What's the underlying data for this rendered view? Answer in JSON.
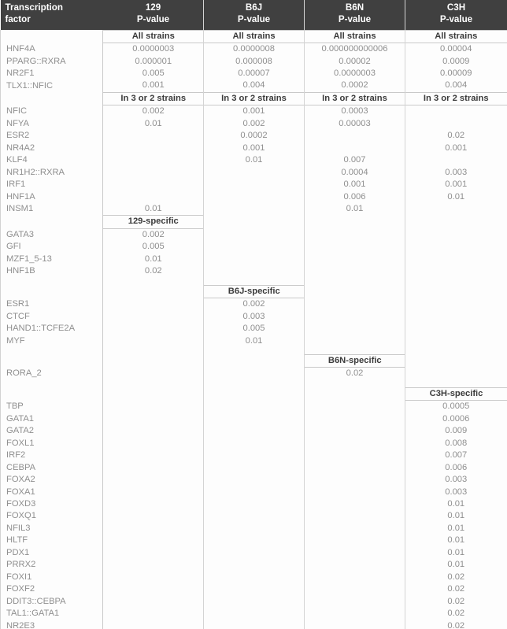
{
  "header": {
    "tf_label_line1": "Transcription",
    "tf_label_line2": "factor",
    "columns": [
      {
        "name": "129",
        "sub": "P-value"
      },
      {
        "name": "B6J",
        "sub": "P-value"
      },
      {
        "name": "B6N",
        "sub": "P-value"
      },
      {
        "name": "C3H",
        "sub": "P-value"
      }
    ]
  },
  "section_labels": {
    "all_strains": "All strains",
    "in_3_or_2": "In 3 or 2 strains",
    "s129_specific": "129-specific",
    "b6j_specific": "B6J-specific",
    "b6n_specific": "B6N-specific",
    "c3h_specific": "C3H-specific"
  },
  "colors": {
    "header_bg": "#404040",
    "header_text": "#ffffff",
    "body_text": "#8f8f8f",
    "section_text": "#3b3b3b",
    "rule": "#c9c9c9"
  },
  "rows": [
    {
      "type": "section",
      "cells": [
        "All strains",
        "All strains",
        "All strains",
        "All strains"
      ]
    },
    {
      "type": "data",
      "tf": "HNF4A",
      "cells": [
        "0.0000003",
        "0.0000008",
        "0.000000000006",
        "0.00004"
      ]
    },
    {
      "type": "data",
      "tf": "PPARG::RXRA",
      "cells": [
        "0.000001",
        "0.000008",
        "0.00002",
        "0.0009"
      ]
    },
    {
      "type": "data",
      "tf": "NR2F1",
      "cells": [
        "0.005",
        "0.00007",
        "0.0000003",
        "0.00009"
      ]
    },
    {
      "type": "data",
      "tf": "TLX1::NFIC",
      "cells": [
        "0.001",
        "0.004",
        "0.0002",
        "0.004"
      ]
    },
    {
      "type": "section",
      "cells": [
        "In 3 or 2 strains",
        "In 3 or 2 strains",
        "In 3 or 2 strains",
        "In 3 or 2 strains"
      ]
    },
    {
      "type": "data",
      "tf": "NFIC",
      "cells": [
        "0.002",
        "0.001",
        "0.0003",
        ""
      ]
    },
    {
      "type": "data",
      "tf": "NFYA",
      "cells": [
        "0.01",
        "0.002",
        "0.00003",
        ""
      ]
    },
    {
      "type": "data",
      "tf": "ESR2",
      "cells": [
        "",
        "0.0002",
        "",
        "0.02"
      ]
    },
    {
      "type": "data",
      "tf": "NR4A2",
      "cells": [
        "",
        "0.001",
        "",
        "0.001"
      ]
    },
    {
      "type": "data",
      "tf": "KLF4",
      "cells": [
        "",
        "0.01",
        "0.007",
        ""
      ]
    },
    {
      "type": "data",
      "tf": "NR1H2::RXRA",
      "cells": [
        "",
        "",
        "0.0004",
        "0.003"
      ]
    },
    {
      "type": "data",
      "tf": "IRF1",
      "cells": [
        "",
        "",
        "0.001",
        "0.001"
      ]
    },
    {
      "type": "data",
      "tf": "HNF1A",
      "cells": [
        "",
        "",
        "0.006",
        "0.01"
      ]
    },
    {
      "type": "data",
      "tf": "INSM1",
      "cells": [
        "0.01",
        "",
        "0.01",
        ""
      ]
    },
    {
      "type": "section_partial",
      "col": 0,
      "label": "129-specific"
    },
    {
      "type": "data",
      "tf": "GATA3",
      "cells": [
        "0.002",
        "",
        "",
        ""
      ]
    },
    {
      "type": "data",
      "tf": "GFI",
      "cells": [
        "0.005",
        "",
        "",
        ""
      ]
    },
    {
      "type": "data",
      "tf": "MZF1_5-13",
      "cells": [
        "0.01",
        "",
        "",
        ""
      ]
    },
    {
      "type": "data",
      "tf": "HNF1B",
      "cells": [
        "0.02",
        "",
        "",
        ""
      ]
    },
    {
      "type": "gap"
    },
    {
      "type": "section_partial",
      "col": 1,
      "label": "B6J-specific"
    },
    {
      "type": "data",
      "tf": "ESR1",
      "cells": [
        "",
        "0.002",
        "",
        ""
      ]
    },
    {
      "type": "data",
      "tf": "CTCF",
      "cells": [
        "",
        "0.003",
        "",
        ""
      ]
    },
    {
      "type": "data",
      "tf": "HAND1::TCFE2A",
      "cells": [
        "",
        "0.005",
        "",
        ""
      ]
    },
    {
      "type": "data",
      "tf": "MYF",
      "cells": [
        "",
        "0.01",
        "",
        ""
      ]
    },
    {
      "type": "gap"
    },
    {
      "type": "section_partial",
      "col": 2,
      "label": "B6N-specific"
    },
    {
      "type": "data",
      "tf": "RORA_2",
      "cells": [
        "",
        "",
        "0.02",
        ""
      ]
    },
    {
      "type": "gap"
    },
    {
      "type": "section_partial",
      "col": 3,
      "label": "C3H-specific"
    },
    {
      "type": "data",
      "tf": "TBP",
      "cells": [
        "",
        "",
        "",
        "0.0005"
      ]
    },
    {
      "type": "data",
      "tf": "GATA1",
      "cells": [
        "",
        "",
        "",
        "0.0006"
      ]
    },
    {
      "type": "data",
      "tf": "GATA2",
      "cells": [
        "",
        "",
        "",
        "0.009"
      ]
    },
    {
      "type": "data",
      "tf": "FOXL1",
      "cells": [
        "",
        "",
        "",
        "0.008"
      ]
    },
    {
      "type": "data",
      "tf": "IRF2",
      "cells": [
        "",
        "",
        "",
        "0.007"
      ]
    },
    {
      "type": "data",
      "tf": "CEBPA",
      "cells": [
        "",
        "",
        "",
        "0.006"
      ]
    },
    {
      "type": "data",
      "tf": "FOXA2",
      "cells": [
        "",
        "",
        "",
        "0.003"
      ]
    },
    {
      "type": "data",
      "tf": "FOXA1",
      "cells": [
        "",
        "",
        "",
        "0.003"
      ]
    },
    {
      "type": "data",
      "tf": "FOXD3",
      "cells": [
        "",
        "",
        "",
        "0.01"
      ]
    },
    {
      "type": "data",
      "tf": "FOXQ1",
      "cells": [
        "",
        "",
        "",
        "0.01"
      ]
    },
    {
      "type": "data",
      "tf": "NFIL3",
      "cells": [
        "",
        "",
        "",
        "0.01"
      ]
    },
    {
      "type": "data",
      "tf": "HLTF",
      "cells": [
        "",
        "",
        "",
        "0.01"
      ]
    },
    {
      "type": "data",
      "tf": "PDX1",
      "cells": [
        "",
        "",
        "",
        "0.01"
      ]
    },
    {
      "type": "data",
      "tf": "PRRX2",
      "cells": [
        "",
        "",
        "",
        "0.01"
      ]
    },
    {
      "type": "data",
      "tf": "FOXI1",
      "cells": [
        "",
        "",
        "",
        "0.02"
      ]
    },
    {
      "type": "data",
      "tf": "FOXF2",
      "cells": [
        "",
        "",
        "",
        "0.02"
      ]
    },
    {
      "type": "data",
      "tf": "DDIT3::CEBPA",
      "cells": [
        "",
        "",
        "",
        "0.02"
      ]
    },
    {
      "type": "data",
      "tf": "TAL1::GATA1",
      "cells": [
        "",
        "",
        "",
        "0.02"
      ]
    },
    {
      "type": "data",
      "tf": "NR2E3",
      "cells": [
        "",
        "",
        "",
        "0.02"
      ]
    }
  ]
}
